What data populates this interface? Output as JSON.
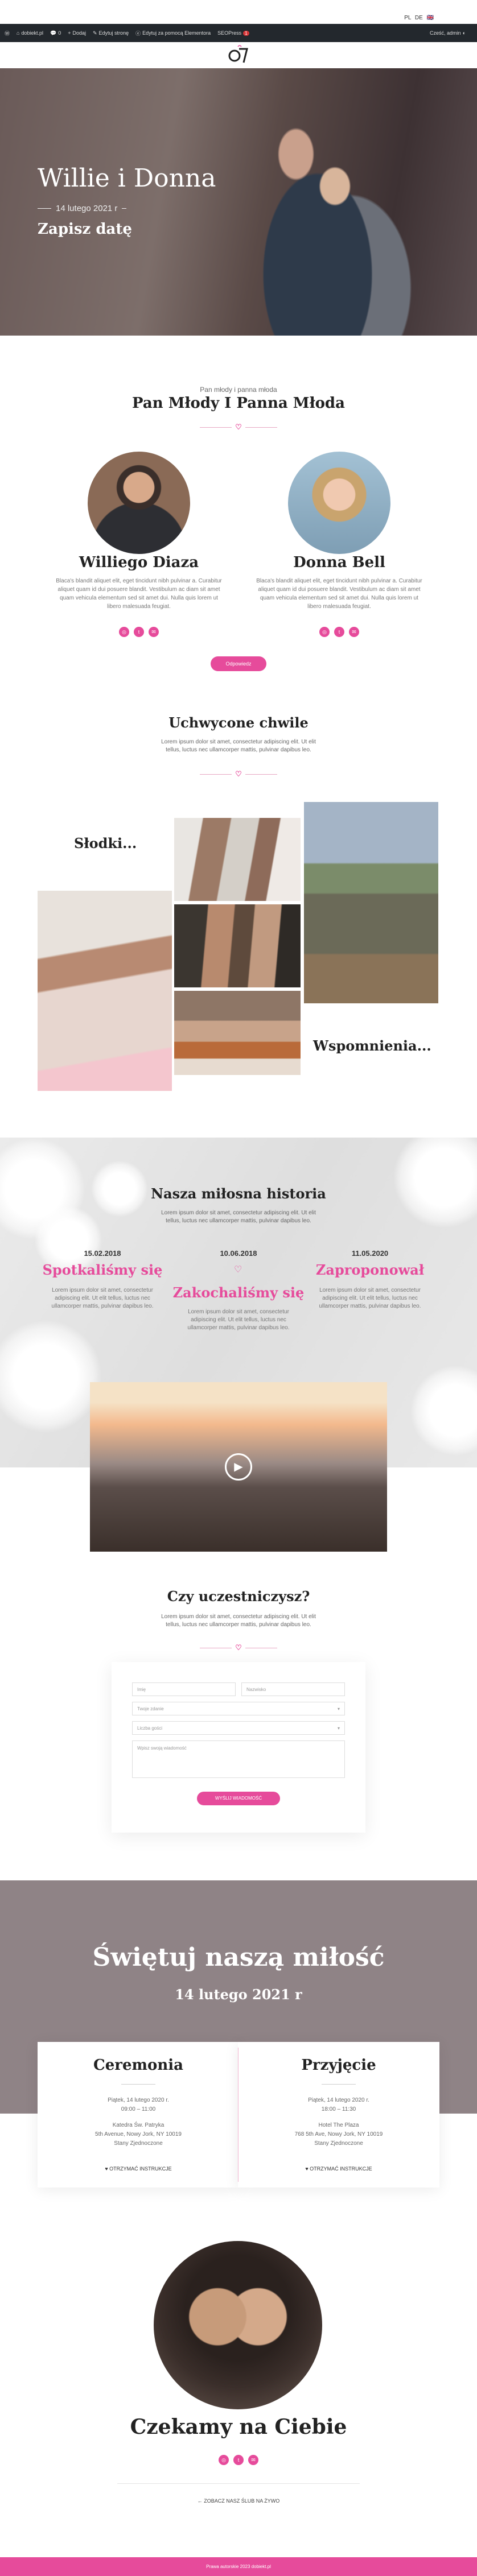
{
  "lang": {
    "pl": "PL",
    "de": "DE",
    "gb_label": "🇬🇧"
  },
  "wpbar": {
    "items": [
      "",
      "dobiekt.pl",
      "0",
      "Dodaj",
      "",
      "Edytuj stronę",
      "Edytuj za pomocą Elementora",
      "SEOPress"
    ],
    "badge": "1",
    "account": "Cześć, admin"
  },
  "hero": {
    "title": "Willie i Donna",
    "date": "14 lutego 2021 r",
    "save": "Zapisz datę"
  },
  "couple": {
    "eyebrow": "Pan młody i panna młoda",
    "title": "Pan Młody I Panna Młoda",
    "groom_name": "Williego Diaza",
    "groom_desc": "Blaca's blandit aliquet elit, eget tincidunt nibh pulvinar a. Curabitur aliquet quam id dui posuere blandit. Vestibulum ac diam sit amet quam vehicula elementum sed sit amet dui. Nulla quis lorem ut libero malesuada feugiat.",
    "bride_name": "Donna Bell",
    "bride_desc": "Blaca's blandit aliquet elit, eget tincidunt nibh pulvinar a. Curabitur aliquet quam id dui posuere blandit. Vestibulum ac diam sit amet quam vehicula elementum sed sit amet dui. Nulla quis lorem ut libero malesuada feugiat.",
    "button": "Odpowiedz"
  },
  "moments": {
    "title": "Uchwycone chwile",
    "text": "Lorem ipsum dolor sit amet, consectetur adipiscing elit. Ut elit tellus, luctus nec ullamcorper mattis, pulvinar dapibus leo.",
    "sweet": "Słodki...",
    "memories": "Wspomnienia..."
  },
  "story": {
    "title": "Nasza miłosna historia",
    "text": "Lorem ipsum dolor sit amet, consectetur adipiscing elit. Ut elit tellus, luctus nec ullamcorper mattis, pulvinar dapibus leo.",
    "events": [
      {
        "date": "15.02.2018",
        "title": "Spotkaliśmy się",
        "text": "Lorem ipsum dolor sit amet, consectetur adipiscing elit. Ut elit tellus, luctus nec ullamcorper mattis, pulvinar dapibus leo."
      },
      {
        "date": "10.06.2018",
        "title": "Zakochaliśmy się",
        "text": "Lorem ipsum dolor sit amet, consectetur adipiscing elit. Ut elit tellus, luctus nec ullamcorper mattis, pulvinar dapibus leo."
      },
      {
        "date": "11.05.2020",
        "title": "Zaproponował",
        "text": "Lorem ipsum dolor sit amet, consectetur adipiscing elit. Ut elit tellus, luctus nec ullamcorper mattis, pulvinar dapibus leo."
      }
    ]
  },
  "rsvp": {
    "title": "Czy uczestniczysz?",
    "text": "Lorem ipsum dolor sit amet, consectetur adipiscing elit. Ut elit tellus, luctus nec ullamcorper mattis, pulvinar dapibus leo.",
    "name_placeholder": "Imię",
    "surname_placeholder": "Nazwisko",
    "attend_select": "Twoje zdanie",
    "guests_select": "Liczba gości",
    "message_placeholder": "Wpisz swoją wiadomość",
    "submit": "WYŚLIJ WIADOMOŚĆ"
  },
  "celebrate": {
    "title": "Świętuj naszą miłość",
    "date": "14 lutego 2021 r"
  },
  "ceremony": {
    "title": "Ceremonia",
    "when": "Piątek, 14 lutego 2020 r.",
    "time": "09:00 – 11:00",
    "place": "Katedra Św. Patryka",
    "address": "5th Avenue, Nowy Jork, NY 10019",
    "country": "Stany Zjednoczone",
    "button": "OTRZYMAĆ INSTRUKCJE"
  },
  "reception": {
    "title": "Przyjęcie",
    "when": "Piątek, 14 lutego 2020 r.",
    "time": "18:00 – 11:30",
    "place": "Hotel The Plaza",
    "address": "768 5th Ave, Nowy Jork, NY 10019",
    "country": "Stany Zjednoczone",
    "button": "OTRZYMAĆ INSTRUKCJE"
  },
  "waiting": {
    "title": "Czekamy na Ciebie",
    "link": "← ZOBACZ NASZ ŚLUB NA ŻYWO"
  },
  "footer": {
    "text": "Prawa autorskie 2023 dobiekt.pl"
  },
  "colors": {
    "accent": "#e64b9b",
    "dark_band": "#8f8386",
    "wp_bar": "#23282d"
  }
}
